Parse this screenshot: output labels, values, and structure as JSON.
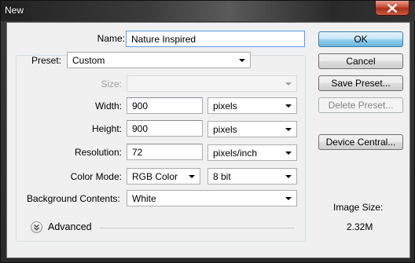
{
  "window": {
    "title": "New"
  },
  "form": {
    "name_label": "Name:",
    "name_value": "Nature Inspired",
    "preset_label": "Preset:",
    "preset_value": "Custom",
    "size_label": "Size:",
    "size_value": "",
    "width_label": "Width:",
    "width_value": "900",
    "width_unit": "pixels",
    "height_label": "Height:",
    "height_value": "900",
    "height_unit": "pixels",
    "resolution_label": "Resolution:",
    "resolution_value": "72",
    "resolution_unit": "pixels/inch",
    "color_mode_label": "Color Mode:",
    "color_mode_value": "RGB Color",
    "bit_depth_value": "8 bit",
    "background_label": "Background Contents:",
    "background_value": "White",
    "advanced_label": "Advanced"
  },
  "buttons": {
    "ok": "OK",
    "cancel": "Cancel",
    "save_preset": "Save Preset...",
    "delete_preset": "Delete Preset...",
    "device_central": "Device Central..."
  },
  "info": {
    "image_size_label": "Image Size:",
    "image_size_value": "2.32M"
  },
  "icons": {
    "close": "close-icon",
    "dropdown": "chevron-down-icon",
    "advanced": "double-chevron-down-icon"
  }
}
